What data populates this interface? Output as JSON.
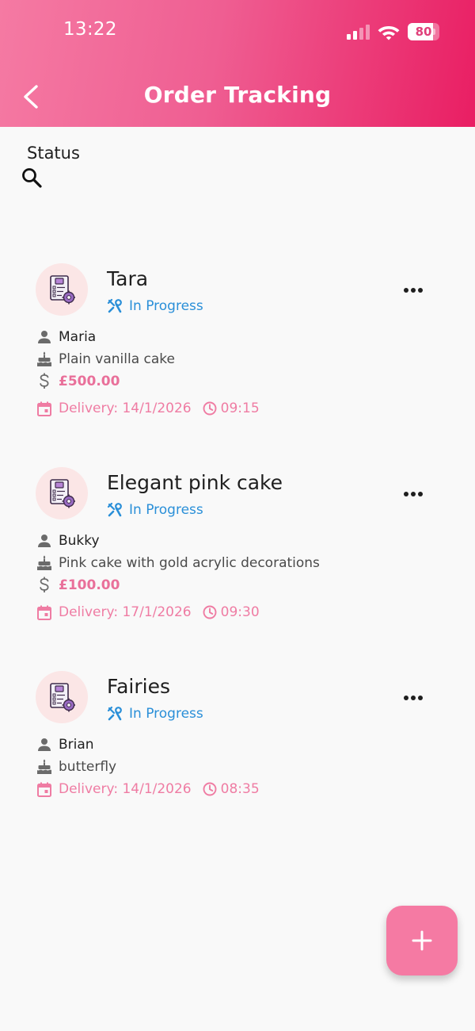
{
  "status_bar": {
    "time": "13:22",
    "battery_level": "80",
    "battery_percent": 80,
    "icons": [
      "signal-icon",
      "wifi-icon",
      "battery-icon"
    ]
  },
  "header": {
    "title": "Order Tracking",
    "back_icon": "chevron-left-icon"
  },
  "filter": {
    "label": "Status",
    "search_icon": "search-icon"
  },
  "orders": [
    {
      "title": "Tara",
      "status": "In Progress",
      "customer": "Maria",
      "description": "Plain vanilla cake",
      "price": "£500.00",
      "delivery": "Delivery: 14/1/2026",
      "time": "09:15"
    },
    {
      "title": "Elegant pink cake",
      "status": "In Progress",
      "customer": "Bukky",
      "description": "Pink cake with gold acrylic decorations",
      "price": "£100.00",
      "delivery": "Delivery: 17/1/2026",
      "time": "09:30"
    },
    {
      "title": "Fairies",
      "status": "In Progress",
      "customer": "Brian",
      "description": "butterfly",
      "price": null,
      "delivery": "Delivery: 14/1/2026",
      "time": "08:35"
    }
  ],
  "fab": {
    "icon": "plus-icon"
  },
  "colors": {
    "header_gradient_start": "#f57aa3",
    "header_gradient_end": "#e91e63",
    "status_blue": "#2a8fd8",
    "price_pink": "#e9709a",
    "delivery_pink": "#ef7ca3",
    "avatar_bg": "#fbe6e6",
    "fab_bg": "#f57aa3"
  }
}
